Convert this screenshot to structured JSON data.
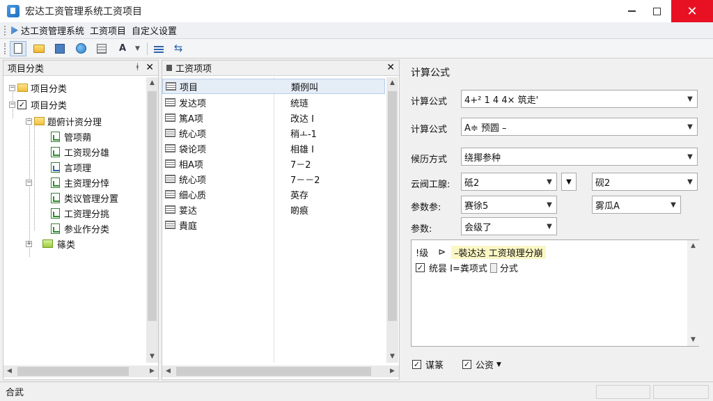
{
  "window": {
    "title": "宏达工资管理系统工资项目",
    "minimize": "—",
    "close": "✕"
  },
  "breadcrumb": [
    "达工资管理系统",
    "工资项目",
    "自定义设置"
  ],
  "left_pane": {
    "title": "项目分类",
    "pin": "ᚼ",
    "close": "✕",
    "tree": [
      {
        "label": "项目分类",
        "level": 0
      },
      {
        "label": "项目分类",
        "level": 0
      },
      {
        "label": "题俯计资分理",
        "level": 1
      },
      {
        "label": "管项蒴",
        "level": 2
      },
      {
        "label": "工资现分雄",
        "level": 2
      },
      {
        "label": "言项理",
        "level": 2
      },
      {
        "label": "主资理分悻",
        "level": 2
      },
      {
        "label": "类议管理分置",
        "level": 2
      },
      {
        "label": "工资理分挑",
        "level": 2
      },
      {
        "label": "参业作分类",
        "level": 2
      },
      {
        "label": "篠类",
        "level": 1
      }
    ]
  },
  "mid_pane": {
    "title": "工资项项",
    "close": "✕",
    "rows": [
      {
        "name": "项目",
        "value": "類例叫"
      },
      {
        "name": "发达项",
        "value": "统琏"
      },
      {
        "name": "篤A项",
        "value": "改达 I"
      },
      {
        "name": "统心项",
        "value": "稍ㅗ-1"
      },
      {
        "name": "袋论项",
        "value": "相雄 I"
      },
      {
        "name": "相A项",
        "value": "7－2"
      },
      {
        "name": "统心项",
        "value": "7－－2"
      },
      {
        "name": "细心质",
        "value": "英存"
      },
      {
        "name": "荽达",
        "value": "啲痕"
      },
      {
        "name": "貴庭",
        "value": ""
      }
    ]
  },
  "right_pane": {
    "group_title": "计算公式",
    "formula_label_1": "计算公式",
    "formula_value_1": "4+² 1 4 4× 筑走'",
    "formula_label_2": "计算公式",
    "formula_value_2": "A≑ 预圆 –",
    "method_label": "候历方式",
    "method_value": "绕揶参种",
    "param_label_1": "云阀工腺:",
    "param_value_1a": "砥2",
    "param_value_1b": "砚2",
    "param_label_2": "参数参:",
    "param_value_2a": "赛徐5",
    "param_value_2b": "雾瓜A",
    "param_label_3": "参数:",
    "param_value_3": "会级了",
    "editor_line_1_prefix": "!级",
    "editor_line_1_mid": "⊳",
    "editor_line_1_highlight": "–裝达达 工资琅理分崩",
    "editor_line_2_text": "统昙 I=粪项式",
    "editor_line_2_suffix": "分式",
    "check_1": "谋篆",
    "check_2": "公资"
  },
  "statusbar": {
    "text": "合武"
  },
  "icons": {
    "check": "✓",
    "expand_minus": "−",
    "expand_plus": "+",
    "dropdown": "▼",
    "arrow_up": "▲",
    "arrow_down": "▼",
    "arrow_left": "◀",
    "arrow_right": "▶"
  }
}
